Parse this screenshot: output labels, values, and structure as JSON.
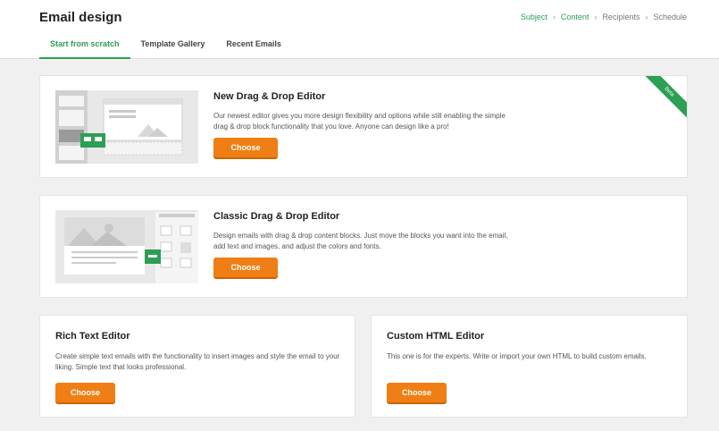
{
  "header": {
    "title": "Email design",
    "breadcrumb": [
      "Subject",
      "Content",
      "Recipients",
      "Schedule"
    ]
  },
  "tabs": [
    {
      "label": "Start from scratch"
    },
    {
      "label": "Template Gallery"
    },
    {
      "label": "Recent Emails"
    }
  ],
  "cards": {
    "new_dnd": {
      "title": "New Drag & Drop Editor",
      "description": "Our newest editor gives you more design flexibility and options while still enabling the simple drag & drop block functionality that you love. Anyone can design like a pro!",
      "button": "Choose",
      "badge": "Beta"
    },
    "classic_dnd": {
      "title": "Classic Drag & Drop Editor",
      "description": "Design emails with drag & drop content blocks. Just move the blocks you want into the email, add text and images, and adjust the colors and fonts.",
      "button": "Choose"
    },
    "rich_text": {
      "title": "Rich Text Editor",
      "description": "Create simple text emails with the functionality to insert images and style the email to your liking. Simple text that looks professional.",
      "button": "Choose"
    },
    "custom_html": {
      "title": "Custom HTML Editor",
      "description": "This one is for the experts. Write or import your own HTML to build custom emails.",
      "button": "Choose"
    }
  },
  "colors": {
    "accent_green": "#2c9f54",
    "button_orange": "#ef7f14",
    "background": "#f0f0f0"
  }
}
